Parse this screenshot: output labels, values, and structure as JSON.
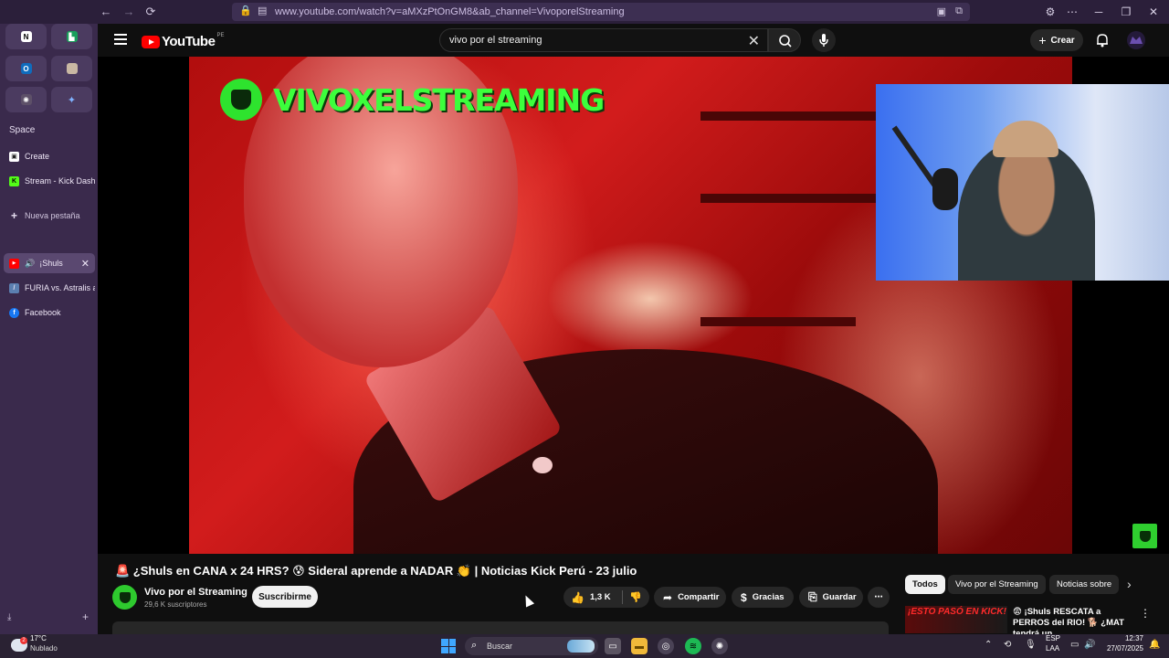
{
  "browser": {
    "url": "www.youtube.com/watch?v=aMXzPtOnGM8&ab_channel=VivoporelStreaming"
  },
  "sidebar": {
    "space_label": "Space",
    "tabs": [
      {
        "label": "Create",
        "icon": "create-icon",
        "color": "#4d8cf5"
      },
      {
        "label": "Stream - Kick Dashb",
        "icon": "kick-icon",
        "color": "#53fc18"
      },
      {
        "label": "Nueva pestaña",
        "icon": "plus-icon",
        "color": "#e6def0"
      },
      {
        "label": "¡Shuls",
        "icon": "youtube-icon",
        "color": "#ff0000",
        "active": true
      },
      {
        "label": "FURIA vs. Astralis at",
        "icon": "hltv-icon",
        "color": "#5b7fb0"
      },
      {
        "label": "Facebook",
        "icon": "facebook-icon",
        "color": "#1877f2"
      }
    ]
  },
  "youtube": {
    "logo": "YouTube",
    "country": "PE",
    "search_value": "vivo por el streaming",
    "create_label": "Crear"
  },
  "video": {
    "watermark_text": "VIVOXELSTREAMING",
    "title": "🚨 ¿Shuls en CANA x 24 HRS? 😰 Sideral aprende a NADAR 👏 | Noticias Kick Perú - 23 julio",
    "channel_name": "Vivo por el Streaming",
    "subscribers": "29,6 K suscriptores",
    "subscribe_label": "Suscribirme",
    "likes": "1,3 K",
    "share_label": "Compartir",
    "thanks_label": "Gracias",
    "save_label": "Guardar"
  },
  "chips": [
    "Todos",
    "Vivo por el Streaming",
    "Noticias sobre"
  ],
  "recommendation": {
    "thumb_text": "¡ESTO PASÓ EN KICK!",
    "title": "😨 ¡Shuls RESCATA a PERROS del RIO! 🐕 ¿MAT tendrá un"
  },
  "taskbar": {
    "temperature": "17°C",
    "condition": "Nublado",
    "weather_badge": "2",
    "search_label": "Buscar",
    "lang1": "ESP",
    "lang2": "LAA",
    "time": "12:37",
    "date": "27/07/2025"
  }
}
